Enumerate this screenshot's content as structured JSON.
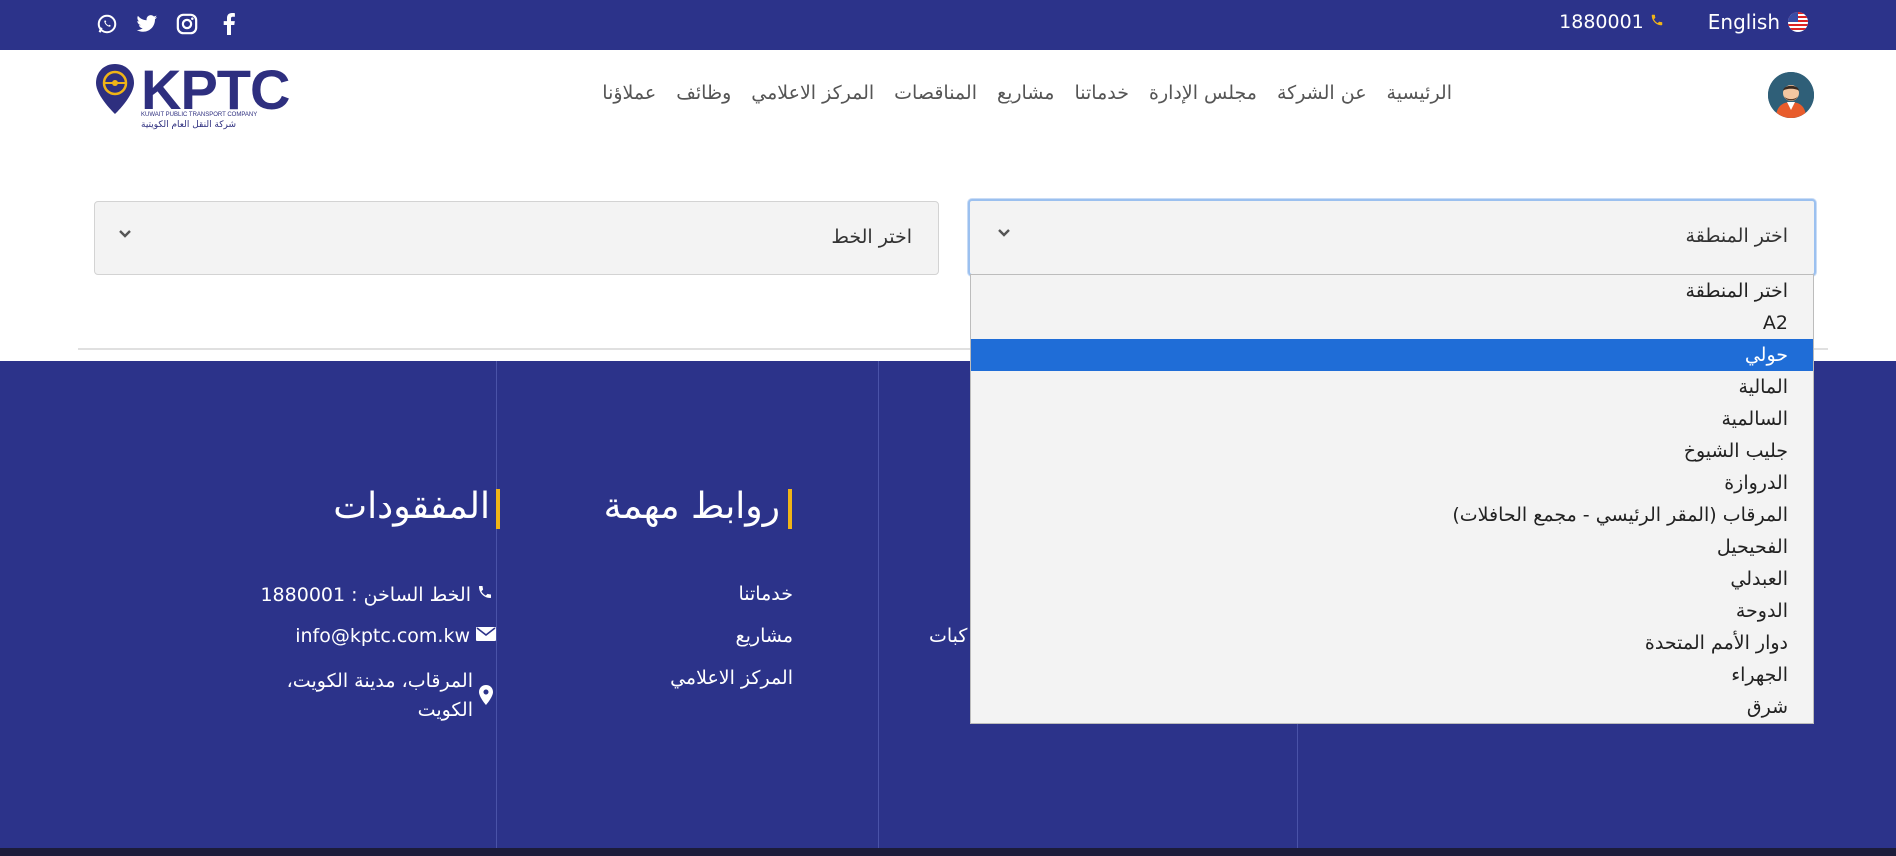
{
  "topbar": {
    "phone": "1880001",
    "language": "English",
    "social": [
      "whatsapp-icon",
      "twitter-icon",
      "instagram-icon",
      "facebook-icon"
    ]
  },
  "header": {
    "logo_text": "KPTC",
    "logo_subtitle_en": "KUWAIT PUBLIC TRANSPORT COMPANY",
    "logo_subtitle_ar": "شركة النقل العام الكويتية",
    "nav": [
      "الرئيسية",
      "عن الشركة",
      "مجلس الإدارة",
      "خدماتنا",
      "مشاريع",
      "المناقصات",
      "المركز الاعلامي",
      "وظائف",
      "عملاؤنا"
    ]
  },
  "filters": {
    "area_select": {
      "value": "اختر المنطقة"
    },
    "line_select": {
      "value": "اختر الخط"
    }
  },
  "dropdown": {
    "options": [
      "اختر المنطقة",
      "A2",
      "حولي",
      "المالية",
      "السالمية",
      "جليب الشيوخ",
      "الدروازة",
      "المرقاب (المقر الرئيسي - مجمع الحافلات)",
      "الفحيحيل",
      "العبدلي",
      "الدوحة",
      "دوار الأمم المتحدة",
      "الجهراء",
      "شرق"
    ],
    "highlighted_index": 2
  },
  "footer": {
    "lost_found": {
      "heading": "المفقودات",
      "hotline": "الخط الساخن : 1880001",
      "email": "info@kptc.com.kw",
      "address_line1": "المرقاب، مدينة الكويت،",
      "address_line2": "الكويت"
    },
    "important_links": {
      "heading": "روابط مهمة",
      "links": [
        "خدماتنا",
        "مشاريع",
        "المركز الاعلامي"
      ]
    },
    "partial_texts": [
      "كبات"
    ]
  },
  "colors": {
    "primary": "#2c338a",
    "accent": "#f0b417",
    "highlight": "#1f6dd7"
  }
}
